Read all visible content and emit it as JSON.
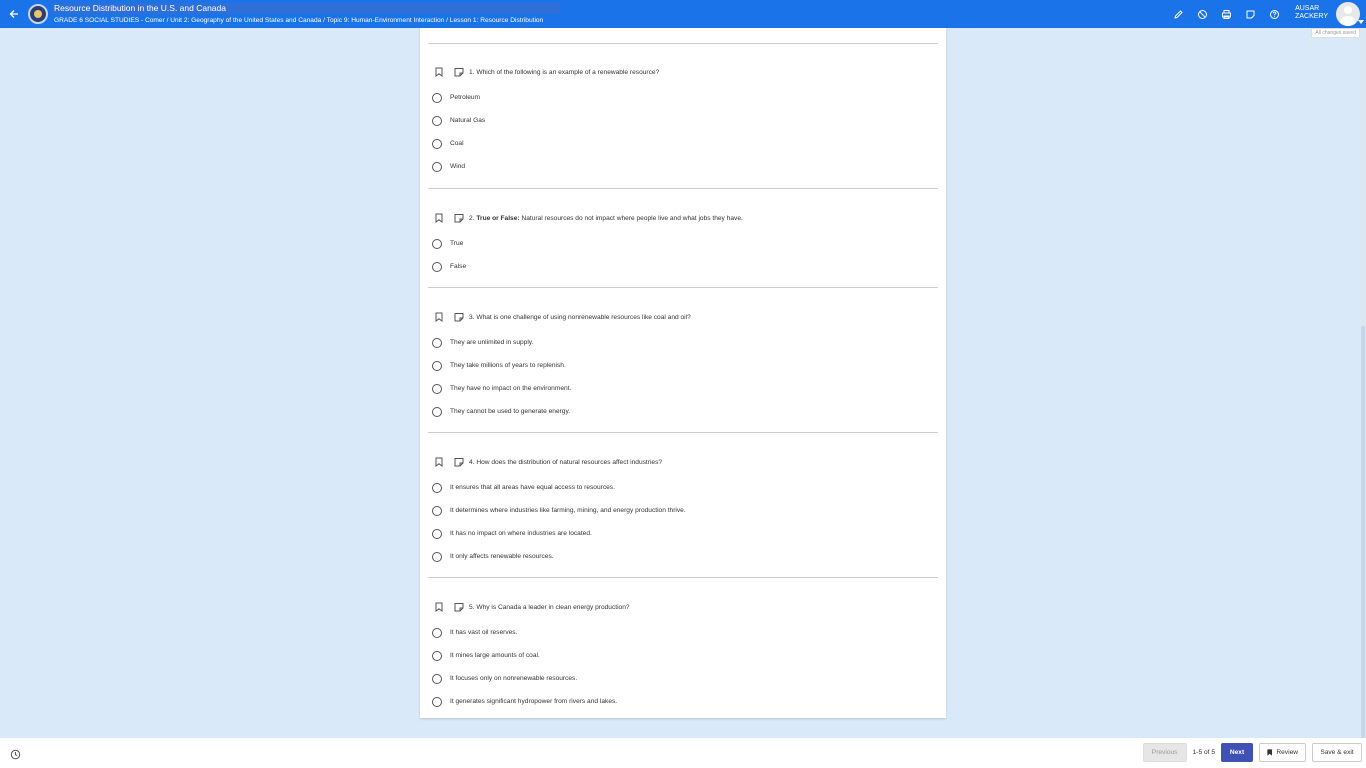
{
  "header": {
    "title": "Resource Distribution in the U.S. and Canada",
    "breadcrumb": "GRADE 6 SOCIAL STUDIES - Comer / Unit 2: Geography of the United States and Canada / Topic 9: Human-Environment Interaction / Lesson 1: Resource Distribution",
    "user_first": "AUSAR",
    "user_last": "ZACKERY",
    "save_status": "All changes saved"
  },
  "questions": [
    {
      "number": "1.",
      "bold": "",
      "text": "Which of the following is an example of a renewable resource?",
      "options": [
        "Petroleum",
        "Natural Gas",
        "Coal",
        "Wind"
      ]
    },
    {
      "number": "2.",
      "bold": "True or False:",
      "text": "Natural resources do not impact where people live and what jobs they have.",
      "options": [
        "True",
        "False"
      ]
    },
    {
      "number": "3.",
      "bold": "",
      "text": "What is one challenge of using nonrenewable resources like coal and oil?",
      "options": [
        "They are unlimited in supply.",
        "They take millions of years to replenish.",
        "They have no impact on the environment.",
        "They cannot be used to generate energy."
      ]
    },
    {
      "number": "4.",
      "bold": "",
      "text": "How does the distribution of natural resources affect industries?",
      "options": [
        "It ensures that all areas have equal access to resources.",
        "It determines where industries like farming, mining, and energy production thrive.",
        "It has no impact on where industries are located.",
        "It only affects renewable resources."
      ]
    },
    {
      "number": "5.",
      "bold": "",
      "text": "Why is Canada a leader in clean energy production?",
      "options": [
        "It has vast oil reserves.",
        "It mines large amounts of coal.",
        "It focuses only on nonrenewable resources.",
        "It generates significant hydropower from rivers and lakes."
      ]
    }
  ],
  "footer": {
    "previous_label": "Previous",
    "pager": "1-5 of 5",
    "next_label": "Next",
    "review_label": "Review",
    "save_exit_label": "Save & exit"
  },
  "colors": {
    "header_bg": "#1a73e8",
    "page_bg": "#d9e9f9",
    "next_button": "#3f51b5"
  }
}
